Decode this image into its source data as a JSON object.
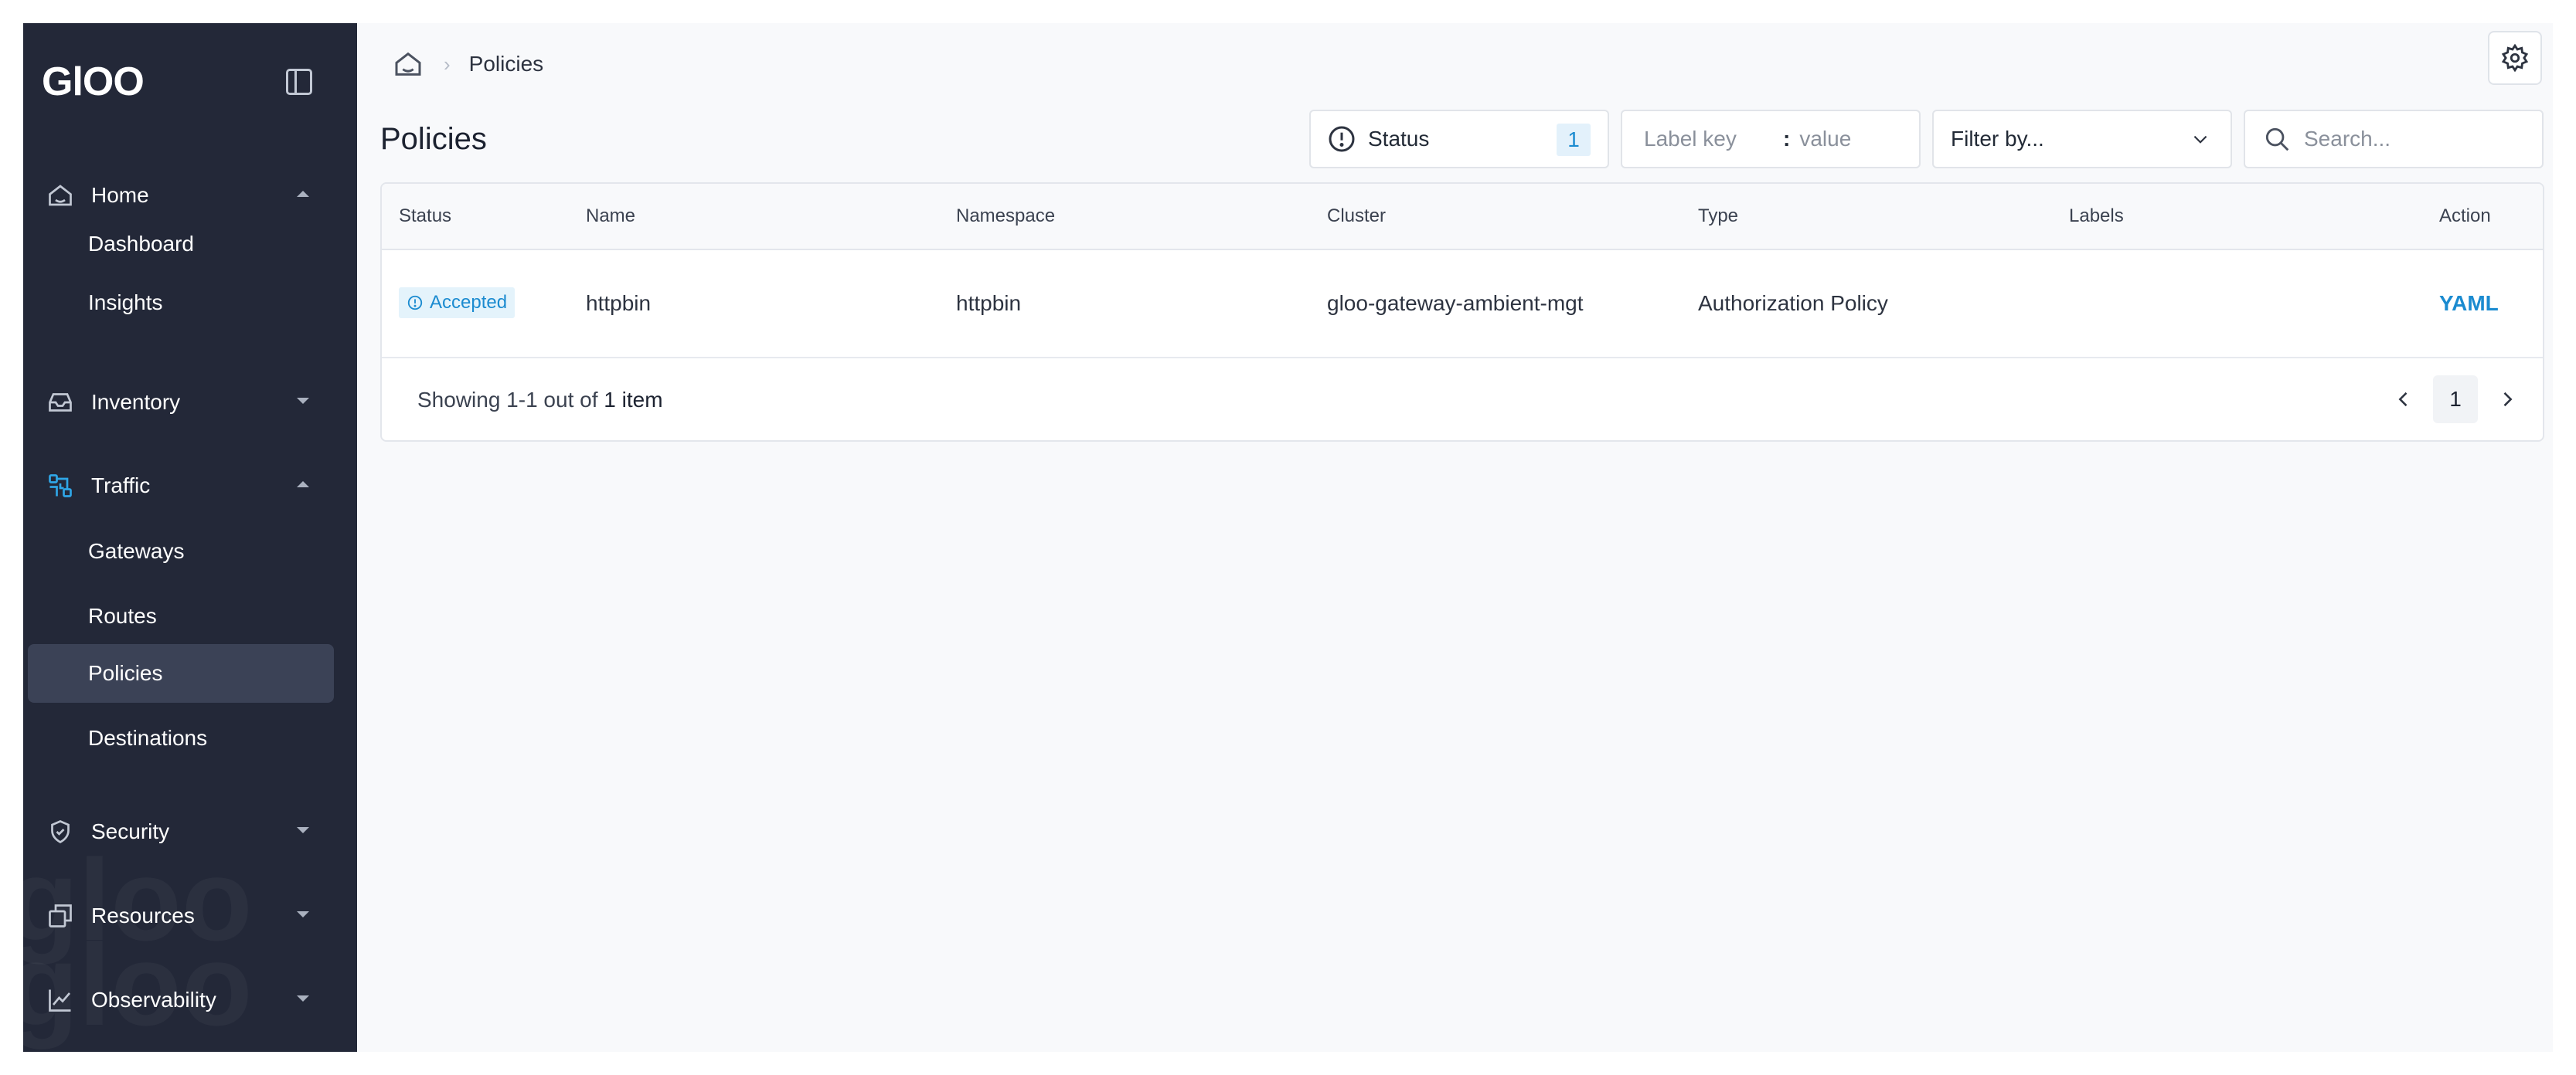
{
  "app": {
    "logo_text": "GlOO"
  },
  "sidebar": {
    "groups": [
      {
        "label": "Home",
        "icon": "home-icon",
        "expanded": true,
        "items": [
          {
            "label": "Dashboard"
          },
          {
            "label": "Insights"
          }
        ]
      },
      {
        "label": "Inventory",
        "icon": "inbox-icon",
        "expanded": false
      },
      {
        "label": "Traffic",
        "icon": "traffic-icon",
        "expanded": true,
        "items": [
          {
            "label": "Gateways"
          },
          {
            "label": "Routes"
          },
          {
            "label": "Policies",
            "active": true
          },
          {
            "label": "Destinations"
          }
        ]
      },
      {
        "label": "Security",
        "icon": "shield-icon",
        "expanded": false
      },
      {
        "label": "Resources",
        "icon": "resources-icon",
        "expanded": false
      },
      {
        "label": "Observability",
        "icon": "chart-icon",
        "expanded": false
      }
    ]
  },
  "breadcrumb": {
    "current": "Policies"
  },
  "page": {
    "title": "Policies"
  },
  "filters": {
    "status": {
      "label": "Status",
      "count": "1"
    },
    "label": {
      "key_placeholder": "Label key",
      "separator": ":",
      "value_placeholder": "value"
    },
    "filter_by": {
      "label": "Filter by..."
    },
    "search": {
      "placeholder": "Search..."
    }
  },
  "table": {
    "columns": [
      "Status",
      "Name",
      "Namespace",
      "Cluster",
      "Type",
      "Labels",
      "Action"
    ],
    "rows": [
      {
        "status": "Accepted",
        "name": "httpbin",
        "namespace": "httpbin",
        "cluster": "gloo-gateway-ambient-mgt",
        "type": "Authorization Policy",
        "labels": "",
        "action": "YAML"
      }
    ],
    "footer": {
      "showing_prefix": "Showing 1-1 out of",
      "showing_count": "1 item"
    }
  },
  "pagination": {
    "current_page": "1"
  },
  "colors": {
    "sidebar_bg": "#232838",
    "accent": "#1b8bd0",
    "active_item": "#3b4256",
    "main_bg": "#f8f9fb"
  }
}
